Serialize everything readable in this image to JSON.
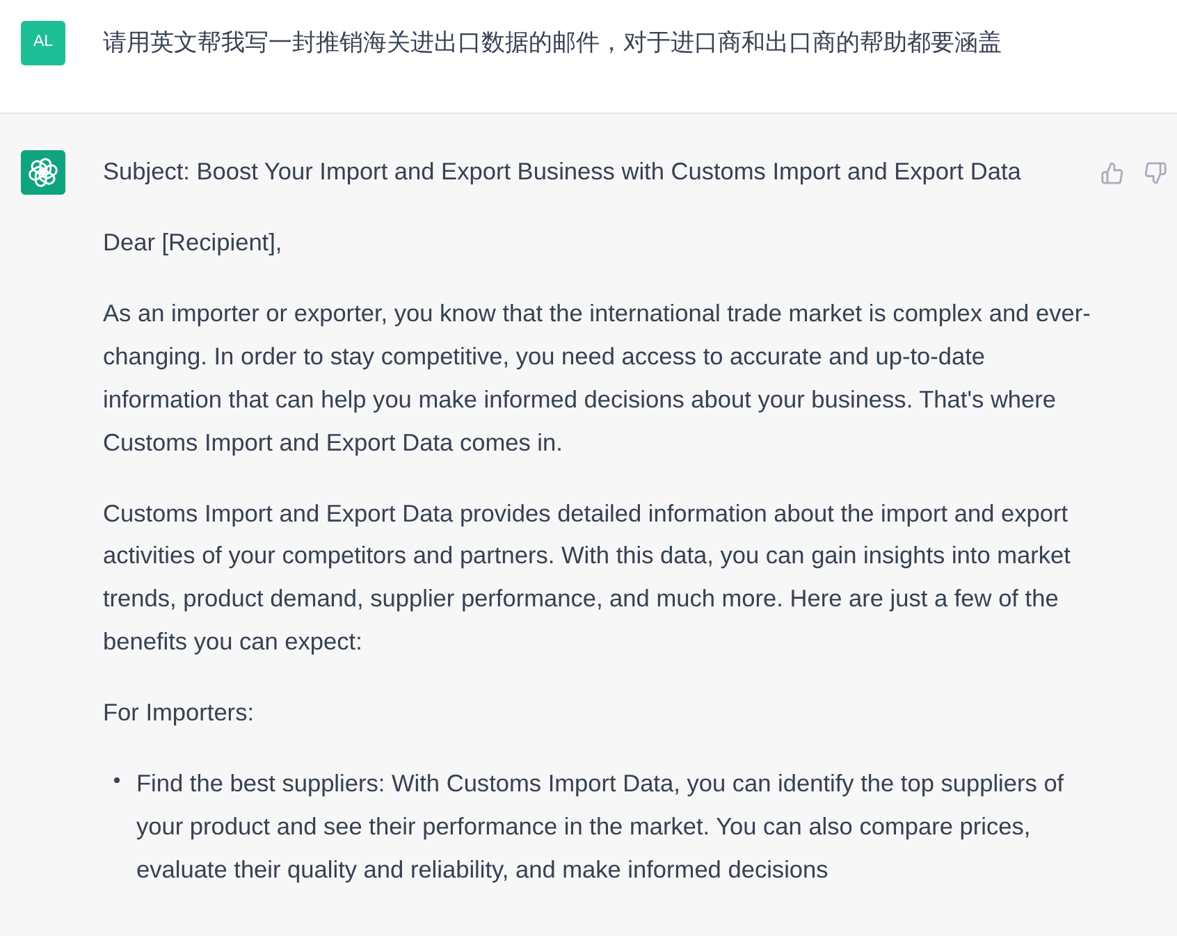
{
  "user_message": {
    "avatar": "AL",
    "text": "请用英文帮我写一封推销海关进出口数据的邮件，对于进口商和出口商的帮助都要涵盖"
  },
  "assistant_message": {
    "paragraphs": [
      {
        "kind": "text",
        "text": "Subject: Boost Your Import and Export Business with Customs Import and Export Data"
      },
      {
        "kind": "text",
        "text": "Dear [Recipient],"
      },
      {
        "kind": "text",
        "text": "As an importer or exporter, you know that the international trade market is complex and ever-changing. In order to stay competitive, you need access to accurate and up-to-date information that can help you make informed decisions about your business. That's where Customs Import and Export Data comes in."
      },
      {
        "kind": "text",
        "text": "Customs Import and Export Data provides detailed information about the import and export activities of your competitors and partners. With this data, you can gain insights into market trends, product demand, supplier performance, and much more. Here are just a few of the benefits you can expect:"
      },
      {
        "kind": "text",
        "text": "For Importers:"
      },
      {
        "kind": "bullet",
        "text": "Find the best suppliers: With Customs Import Data, you can identify the top suppliers of your product and see their performance in the market. You can also compare prices, evaluate their quality and reliability, and make informed decisions"
      }
    ]
  }
}
